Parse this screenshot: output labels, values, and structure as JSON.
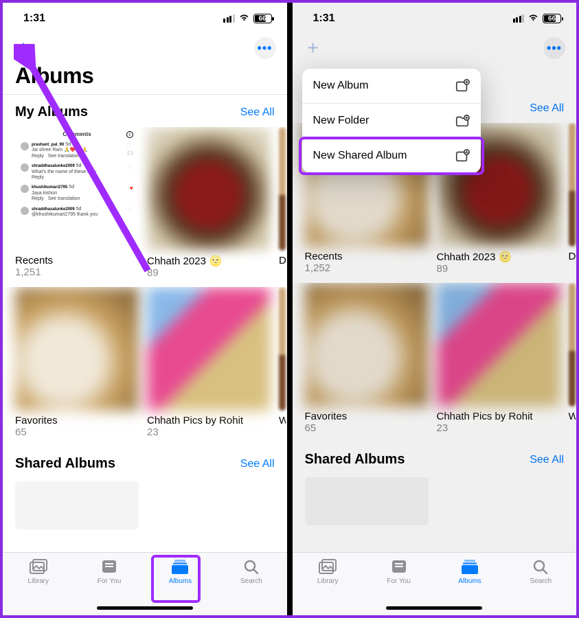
{
  "left": {
    "status": {
      "time": "1:31",
      "battery": "66"
    },
    "title": "Albums",
    "section1": {
      "title": "My Albums",
      "see_all": "See All"
    },
    "albums_row1": [
      {
        "name": "Recents",
        "count": "1,251"
      },
      {
        "name": "Chhath 2023",
        "emoji": "🌝",
        "count": "89"
      },
      {
        "name": "D",
        "count": ""
      }
    ],
    "albums_row2": [
      {
        "name": "Favorites",
        "count": "65"
      },
      {
        "name": "Chhath Pics by Rohit",
        "count": "23"
      },
      {
        "name": "W",
        "count": ""
      }
    ],
    "section2": {
      "title": "Shared Albums",
      "see_all": "See All"
    },
    "recents_comments": {
      "header": "Comments",
      "items": [
        {
          "user": "prashant_pal_90",
          "text": "Jai shree Ram 🙏❤️🙏🙏",
          "likes": "43"
        },
        {
          "user": "shraddhasalunke2009",
          "text": "What's the name of these lady",
          "likes": ""
        },
        {
          "user": "khushikumari2795",
          "text": "Jaya kishori",
          "likes": ""
        },
        {
          "user": "shraddhasalunke2009",
          "text": "@khushikumari2795 thank you",
          "likes": ""
        }
      ]
    },
    "tabs": [
      {
        "label": "Library"
      },
      {
        "label": "For You"
      },
      {
        "label": "Albums"
      },
      {
        "label": "Search"
      }
    ]
  },
  "right": {
    "status": {
      "time": "1:31",
      "battery": "66"
    },
    "menu": [
      {
        "label": "New Album"
      },
      {
        "label": "New Folder"
      },
      {
        "label": "New Shared Album"
      }
    ],
    "section1": {
      "see_all": "See All"
    },
    "albums_row1": [
      {
        "name": "Recents",
        "count": "1,252"
      },
      {
        "name": "Chhath 2023",
        "emoji": "🌝",
        "count": "89"
      },
      {
        "name": "D",
        "count": ""
      }
    ],
    "albums_row2": [
      {
        "name": "Favorites",
        "count": "65"
      },
      {
        "name": "Chhath Pics by Rohit",
        "count": "23"
      },
      {
        "name": "W",
        "count": ""
      }
    ],
    "section2": {
      "title": "Shared Albums",
      "see_all": "See All"
    },
    "tabs": [
      {
        "label": "Library"
      },
      {
        "label": "For You"
      },
      {
        "label": "Albums"
      },
      {
        "label": "Search"
      }
    ]
  }
}
